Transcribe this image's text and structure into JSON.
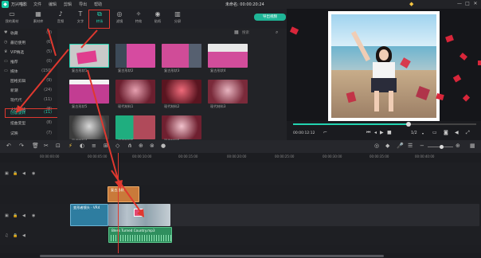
{
  "titlebar": {
    "app_name": "万兴喵影",
    "menu": [
      "文件",
      "编辑",
      "剪辑",
      "导出",
      "帮助"
    ],
    "document": "未命名: 00:00:20:24",
    "win_min": "—",
    "win_max": "□",
    "win_close": "✕"
  },
  "media_tabs": [
    {
      "label": "我的素材",
      "icon": "folder-icon"
    },
    {
      "label": "素材库",
      "icon": "library-icon"
    },
    {
      "label": "音频",
      "icon": "music-icon"
    },
    {
      "label": "文字",
      "icon": "text-icon"
    },
    {
      "label": "转场",
      "icon": "transition-icon",
      "active": true
    },
    {
      "label": "滤镜",
      "icon": "filter-icon"
    },
    {
      "label": "特效",
      "icon": "effect-icon"
    },
    {
      "label": "贴纸",
      "icon": "sticker-icon"
    },
    {
      "label": "分屏",
      "icon": "split-icon"
    }
  ],
  "sidebar": {
    "items": [
      {
        "label": "收藏",
        "count": "(0)"
      },
      {
        "label": "最近使用",
        "count": "(6)"
      },
      {
        "label": "VIP精选",
        "count": "(5)"
      },
      {
        "label": "推荐",
        "count": "(0)"
      },
      {
        "label": "媒体",
        "count": "(150)"
      },
      {
        "label": "图格剪辑",
        "count": "(9)"
      },
      {
        "label": "新潮",
        "count": "(24)"
      },
      {
        "label": "现代代",
        "count": "(11)"
      },
      {
        "label": "大片风格",
        "count": "(8)"
      },
      {
        "label": "创意旋转",
        "count": "(11)"
      },
      {
        "label": "扭曲变型",
        "count": "(8)"
      },
      {
        "label": "试映",
        "count": "(7)"
      }
    ]
  },
  "grid": {
    "search_placeholder": "搜索",
    "items": [
      {
        "label": "复古形状1"
      },
      {
        "label": "复古形状2"
      },
      {
        "label": "复古形状3"
      },
      {
        "label": "复古形状4"
      },
      {
        "label": "复古形状5"
      },
      {
        "label": "现代材料1"
      },
      {
        "label": "现代材料2"
      },
      {
        "label": "现代材料3"
      },
      {
        "label": "现代材料4"
      },
      {
        "label": "现代材料5"
      },
      {
        "label": "现代材料6"
      }
    ]
  },
  "preview": {
    "export_label": "导出视频",
    "timecode": "00:00:12:12",
    "quality": "1/2"
  },
  "timeline": {
    "ruler": [
      "00:00:00:00",
      "00:00:05:00",
      "00:00:10:00",
      "00:00:15:00",
      "00:00:20:00",
      "00:00:25:00",
      "00:00:30:00",
      "00:00:35:00",
      "00:00:40:00",
      "00:00:45:00"
    ],
    "clips": {
      "effect": "复古形状",
      "video1": "变形者镜头 · VR4",
      "audio": "Bless Turned Country.mp3"
    }
  },
  "colors": {
    "accent": "#23d3b0",
    "highlight": "#e0382f"
  }
}
